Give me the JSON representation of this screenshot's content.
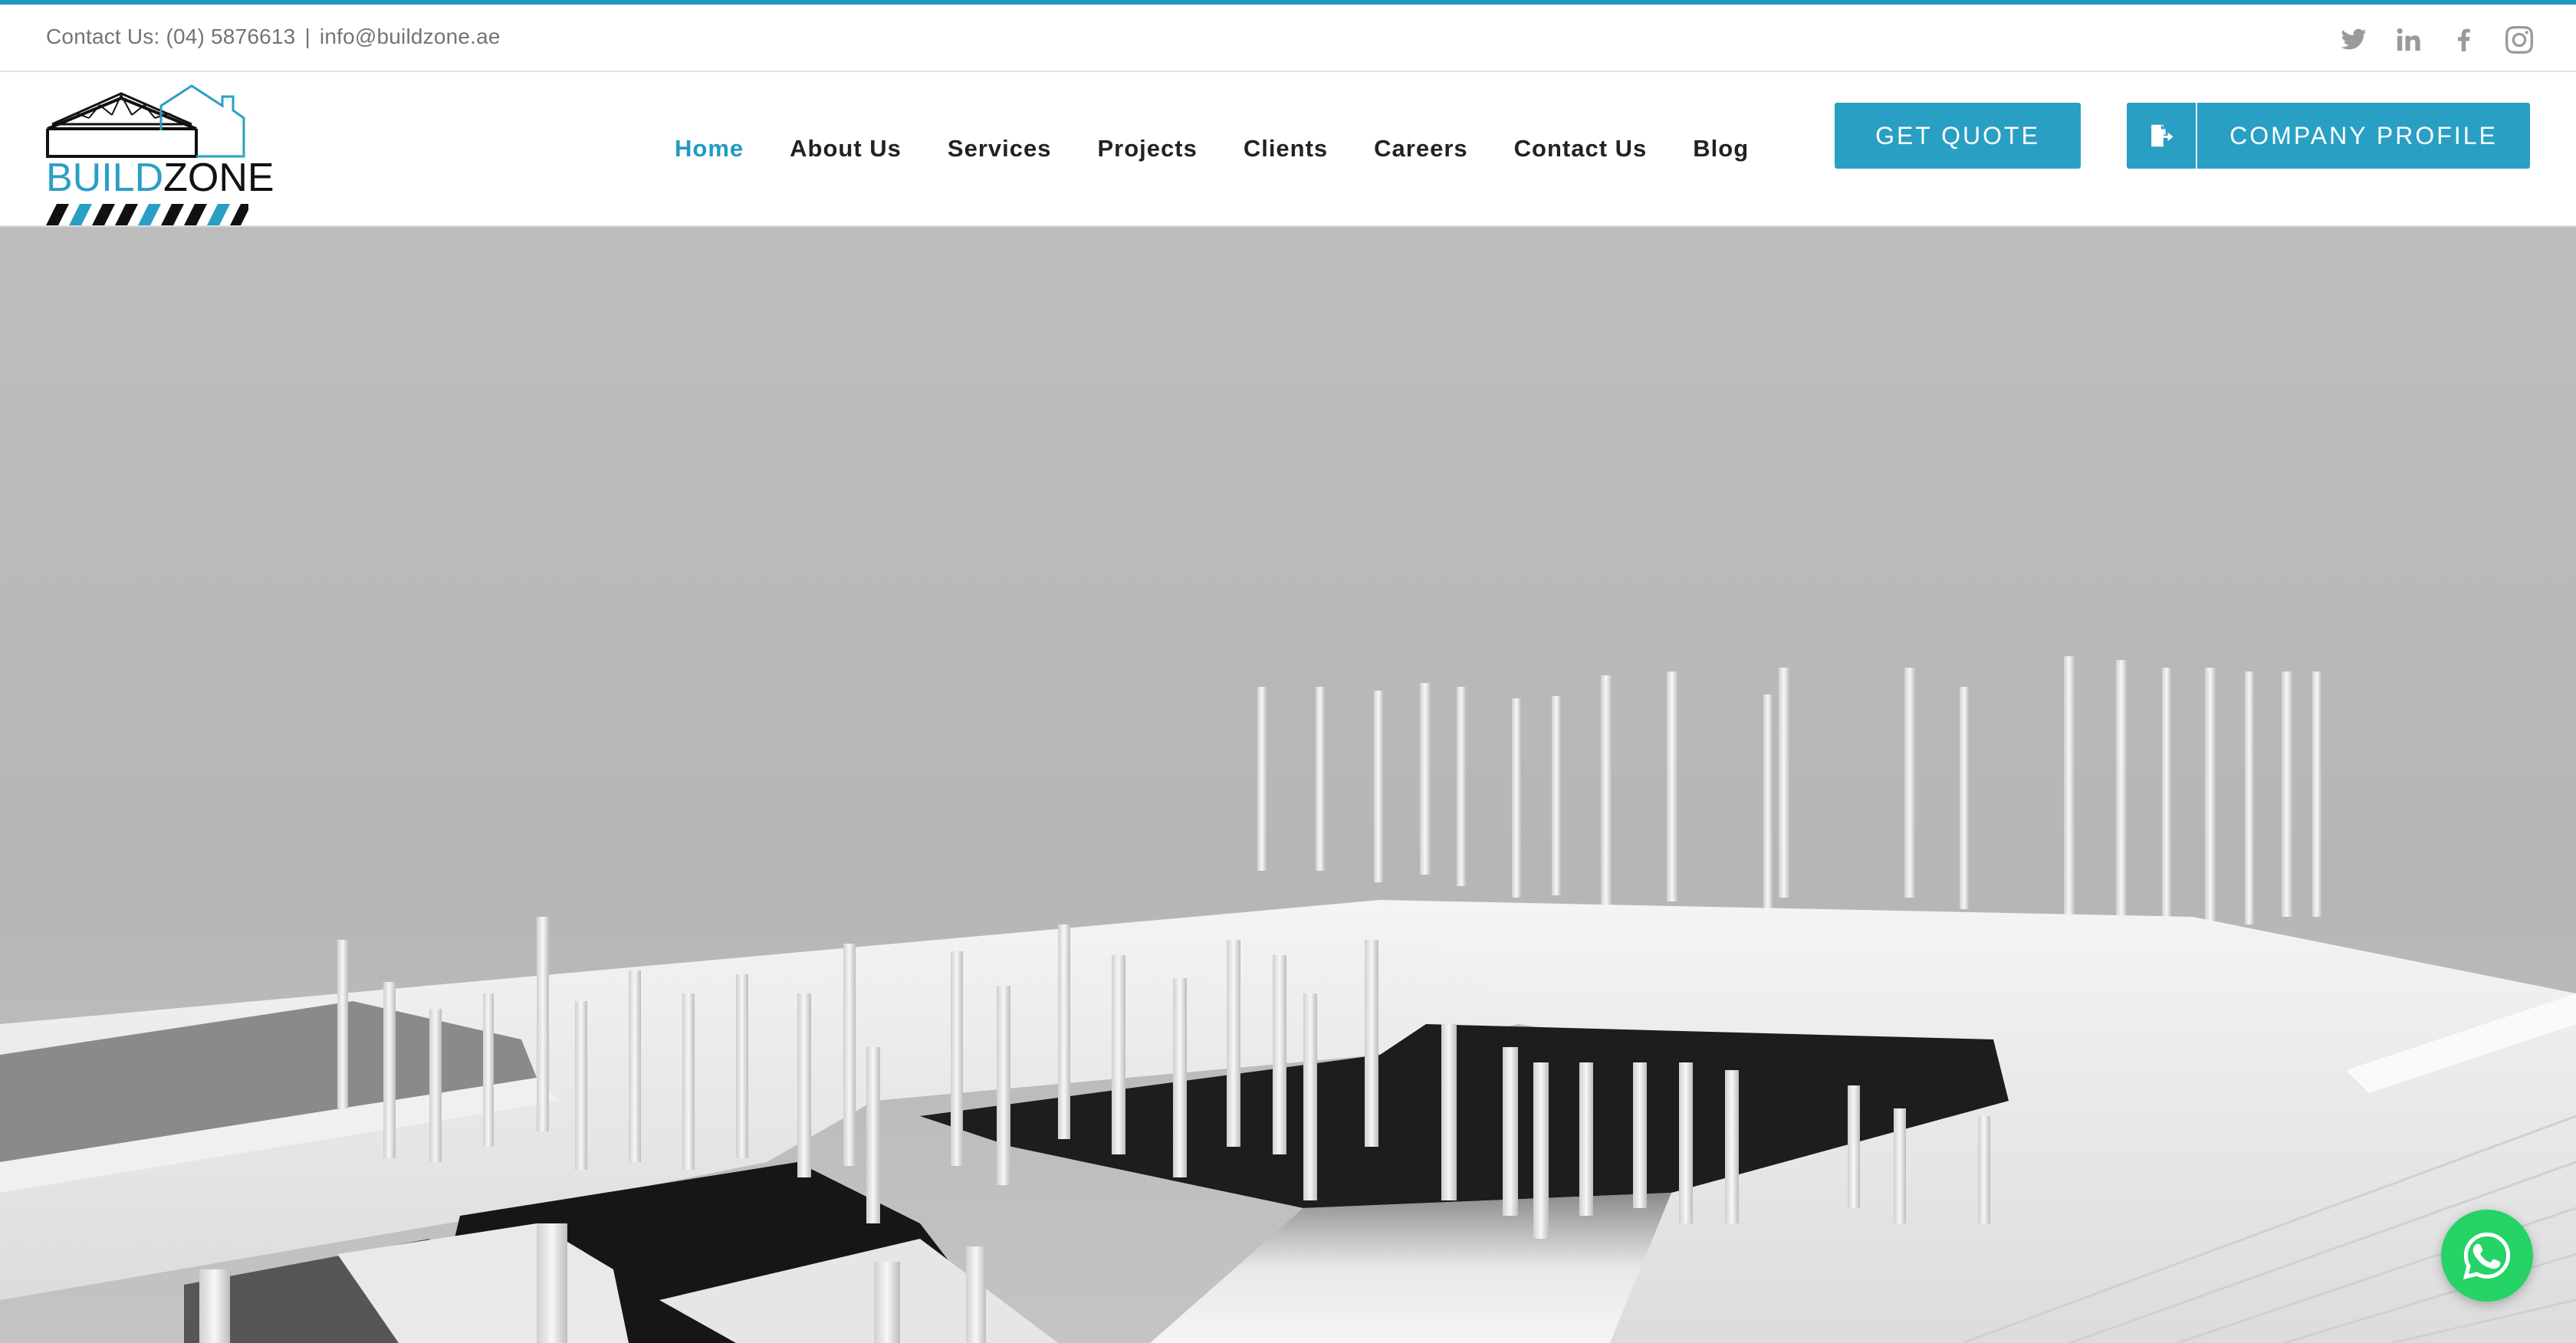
{
  "topbar": {
    "contact_label": "Contact Us: (04) 5876613",
    "separator": "|",
    "email": "info@buildzone.ae",
    "accent_color": "#1f9bbf",
    "socials": [
      {
        "icon": "twitter-icon"
      },
      {
        "icon": "linkedin-icon"
      },
      {
        "icon": "facebook-icon"
      },
      {
        "icon": "instagram-icon"
      }
    ]
  },
  "header": {
    "logo": {
      "word_build": "BUILD",
      "word_zone": "ZONE",
      "brand_color": "#2a9fc4"
    },
    "nav": [
      {
        "label": "Home",
        "active": true
      },
      {
        "label": "About Us"
      },
      {
        "label": "Services"
      },
      {
        "label": "Projects"
      },
      {
        "label": "Clients"
      },
      {
        "label": "Careers"
      },
      {
        "label": "Contact Us"
      },
      {
        "label": "Blog"
      }
    ],
    "quote_button": "GET QUOTE",
    "profile_button": "COMPANY PROFILE",
    "profile_icon": "file-export-icon"
  },
  "hero": {
    "image": "construction-render-image"
  },
  "floating": {
    "whatsapp_icon": "whatsapp-icon",
    "whatsapp_color": "#25d366"
  }
}
